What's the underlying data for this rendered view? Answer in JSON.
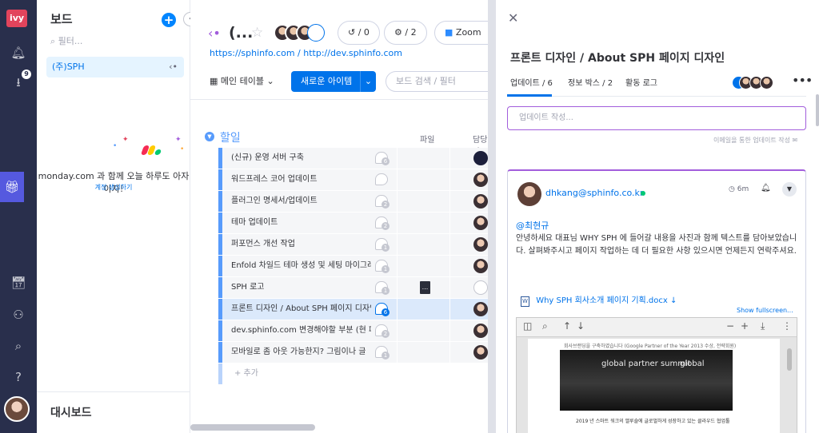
{
  "rail": {
    "logo": "ivy",
    "inbox_badge": "9",
    "icons": [
      "bell-icon",
      "inbox-icon",
      "gift-icon",
      "calendar-icon",
      "invite-user-icon",
      "search-icon",
      "help-icon"
    ]
  },
  "boards_panel": {
    "title": "보드",
    "filter_placeholder": "필터...",
    "items": [
      {
        "label": "(주)SPH"
      }
    ],
    "promo_text": "monday.com 과 함께 오늘 하루도 아자아자!",
    "promo_link": "계정 생성하기",
    "dashboard_title": "대시보드",
    "logo_colors": [
      "#f62b54",
      "#ffcc00",
      "#00ca72"
    ]
  },
  "board": {
    "name": "(...",
    "activity_count": "/ 0",
    "integrations_count": "/ 2",
    "zoom_label": "Zoom",
    "urls": "https://sphinfo.com / http://dev.sphinfo.com",
    "view_label": "메인 테이블",
    "new_item_label": "새로운 아이템",
    "search_placeholder": "보드 검색 / 필터",
    "group_name": "할일",
    "columns": {
      "files": "파일",
      "owner": "담당자"
    },
    "rows": [
      {
        "name": "(신규) 운영 서버 구축",
        "updates": "6",
        "owner": "dark"
      },
      {
        "name": "워드프레스 코어 업데이트",
        "updates": "",
        "owner": "person"
      },
      {
        "name": "플러그인 명세서/업데이트",
        "updates": "2",
        "owner": "person"
      },
      {
        "name": "테마 업데이트",
        "updates": "2",
        "owner": "person"
      },
      {
        "name": "퍼포먼스 개선 작업",
        "updates": "1",
        "owner": "person"
      },
      {
        "name": "Enfold 차일드 테마 생성 및 세팅 마이그레...",
        "updates": "1",
        "owner": "person"
      },
      {
        "name": "SPH 로고",
        "updates": "1",
        "owner": "empty",
        "file": "..."
      },
      {
        "name": "프론트 디자인 / About SPH 페이지 디자인",
        "updates": "6",
        "owner": "person",
        "selected": true
      },
      {
        "name": "dev.sphinfo.com 변경해야할 부분 (현 페...",
        "updates": "2",
        "owner": "person"
      },
      {
        "name": "모바일로 좀 아웃 가능한지? 그림이나 글",
        "updates": "1",
        "owner": "person"
      }
    ],
    "add_label": "+ 추가",
    "accent": "#579bfc"
  },
  "panel": {
    "title": "프론트 디자인 / About SPH 페이지 디자인",
    "tabs": [
      {
        "label": "업데이트 / 6"
      },
      {
        "label": "정보 박스 / 2"
      },
      {
        "label": "활동 로그"
      }
    ],
    "write_placeholder": "업데이트 작성...",
    "email_hint": "이메일을 통한 업데이트 작성",
    "update": {
      "author": "dhkang@sphinfo.co.kr",
      "time": "6m",
      "mention": "@최현규",
      "body": "안녕하세요 대표님 WHY SPH 에 들어갈 내용을 사진과 함께 텍스트를 담아보았습니다. 살펴봐주시고 페이지 작업하는 데 더 필요한 사항 있으시면 언제든지 연락주셔요.",
      "attachment": "Why SPH 회사소개 페이지 기획.docx",
      "show_fullscreen": "Show fullscreen...",
      "doc_header": "회사브랜딩을 구축하였습니다 (Google Partner of the Year 2013 수상, 전략회원)",
      "doc_banner_left": "global partner summit",
      "doc_banner_right": "global",
      "doc_bullet": "2019 년 스마트 워크의 앨루숄에 글로벌하게 성장하고 있는 클라우드 협업툴"
    },
    "accent": "#a25ddc"
  }
}
